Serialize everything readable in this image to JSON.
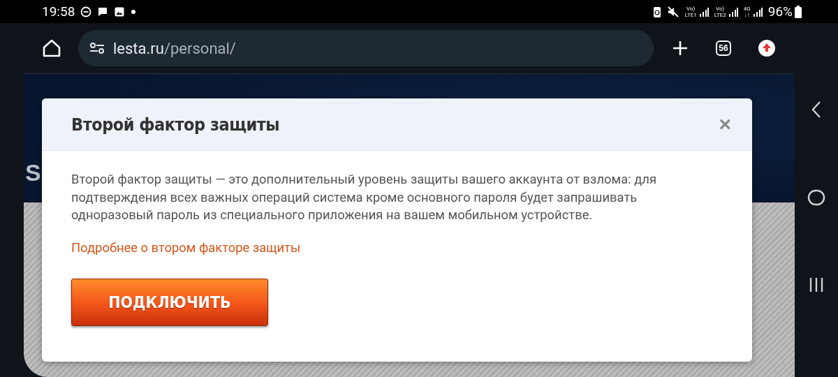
{
  "status_bar": {
    "time": "19:58",
    "networks": [
      {
        "top": "Vo)",
        "bottom": "LTE1"
      },
      {
        "top": "Vo)",
        "bottom": "LTE2"
      },
      {
        "top": "4G",
        "bottom": "↓↑"
      }
    ],
    "battery": "96%"
  },
  "browser": {
    "url_host": "lesta.ru",
    "url_path": "/personal/",
    "tab_count": "56"
  },
  "page_fragments": [
    "S"
  ],
  "dialog": {
    "title": "Второй фактор защиты",
    "close": "×",
    "text": "Второй фактор защиты — это дополнительный уровень защиты вашего аккаунта от взлома: для подтверждения всех важных операций система кроме основного пароля будет запрашивать одноразовый пароль из специального приложения на вашем мобильном устройстве.",
    "link": "Подробнее о втором факторе защиты",
    "button": "ПОДКЛЮЧИТЬ"
  }
}
